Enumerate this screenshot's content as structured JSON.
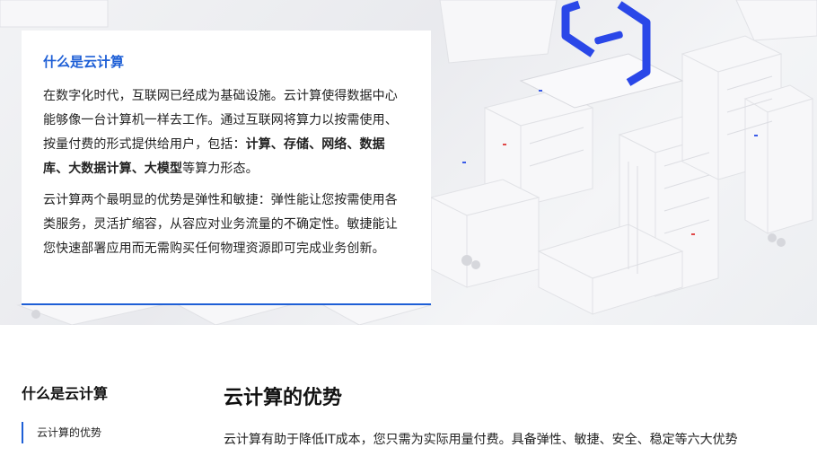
{
  "intro": {
    "title": "什么是云计算",
    "para1_a": "在数字化时代，互联网已经成为基础设施。云计算使得数据中心能够像一台计算机一样去工作。通过互联网将算力以按需使用、按量付费的形式提供给用户，包括：",
    "para1_bold": "计算、存储、网络、数据库、大数据计算、大模型",
    "para1_b": "等算力形态。",
    "para2": "云计算两个最明显的优势是弹性和敏捷：弹性能让您按需使用各类服务，灵活扩缩容，从容应对业务流量的不确定性。敏捷能让您快速部署应用而无需购买任何物理资源即可完成业务创新。"
  },
  "sidebar": {
    "title": "什么是云计算",
    "items": [
      {
        "label": "云计算的优势"
      }
    ]
  },
  "main": {
    "title": "云计算的优势",
    "paragraph": "云计算有助于降低IT成本，您只需为实际用量付费。具备弹性、敏捷、安全、稳定等六大优势"
  },
  "colors": {
    "accent": "#1e5fd6",
    "logo_blue": "#2a47e8"
  }
}
